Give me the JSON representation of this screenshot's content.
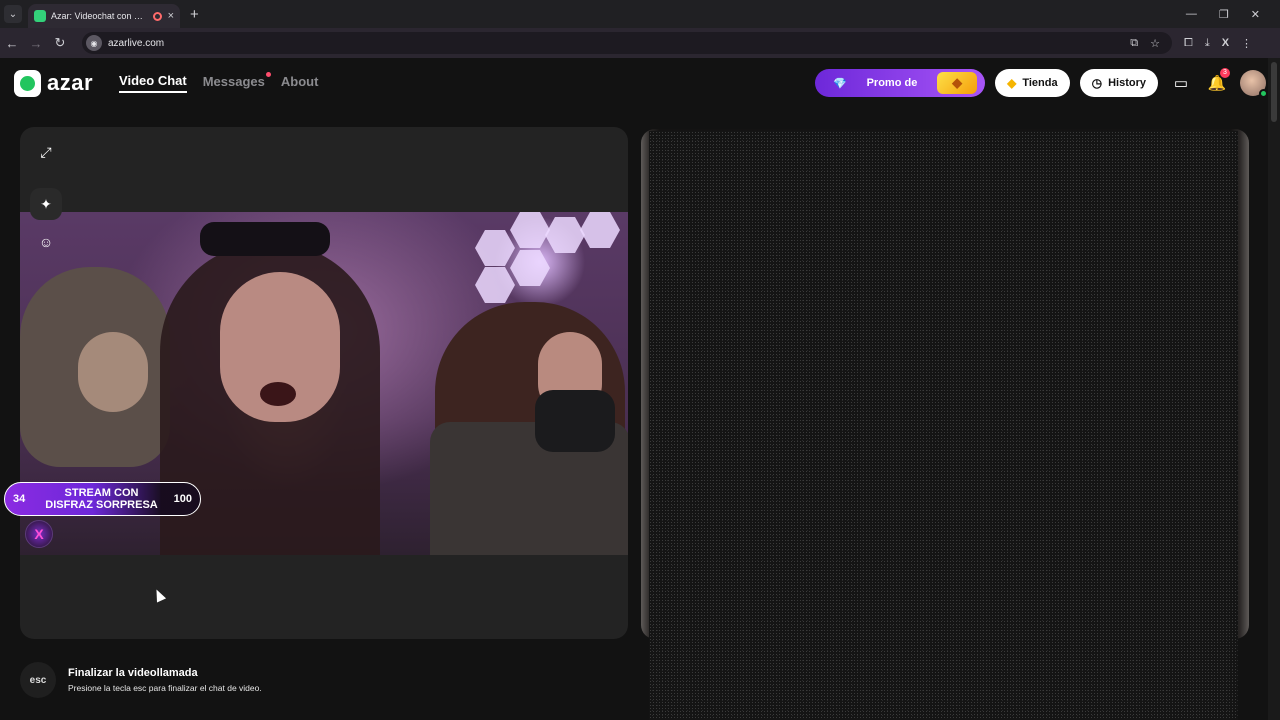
{
  "browser": {
    "tab_title": "Azar: Videochat con gente",
    "url": "azarlive.com",
    "icons": {
      "tab_menu": "chevron-down",
      "tab_close": "×",
      "new_tab": "+",
      "minimize": "—",
      "maximize": "❐",
      "close": "✕",
      "back": "←",
      "forward": "→",
      "reload": "↻",
      "cast": "cast",
      "star": "☆",
      "extensions": "puzzle",
      "download": "download",
      "profile": "X",
      "menu": "⋮"
    }
  },
  "app": {
    "logo_text": "azar",
    "nav": [
      {
        "label": "Video Chat",
        "active": true
      },
      {
        "label": "Messages",
        "active": false,
        "has_dot": true
      },
      {
        "label": "About",
        "active": false
      }
    ],
    "promo_label": "Promo de",
    "store_label": "Tienda",
    "history_label": "History",
    "notification_count": "3",
    "accent_color": "#7c3aed",
    "online_color": "#22c55e"
  },
  "video": {
    "banner": {
      "left_value": "34",
      "text": "STREAM CON DISFRAZ SORPRESA",
      "right_value": "100"
    },
    "side_buttons": [
      "expand-icon",
      "magic-wand-icon",
      "sticker-icon"
    ]
  },
  "footer": {
    "key_label": "esc",
    "title": "Finalizar la videollamada",
    "subtitle": "Presione la tecla esc para finalizar el chat de video."
  }
}
